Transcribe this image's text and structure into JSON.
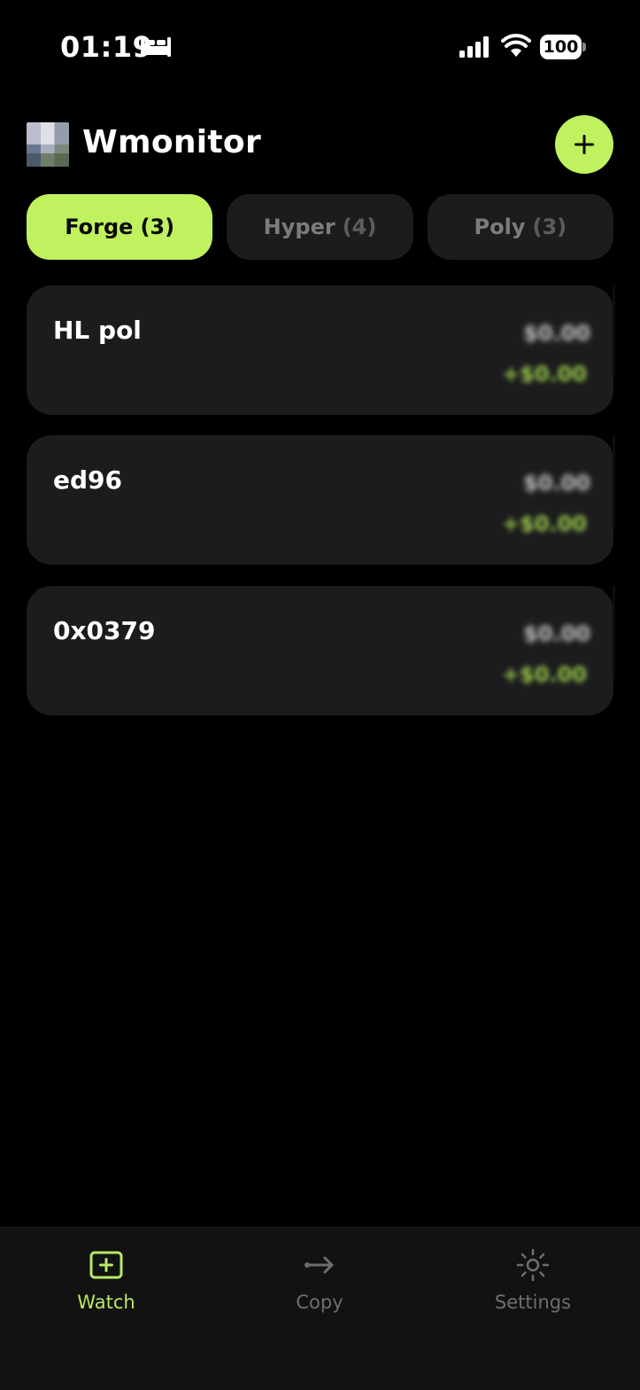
{
  "status_bar": {
    "time": "01:19",
    "battery": "100",
    "icons": [
      "sleep-icon",
      "signal-icon",
      "wifi-icon",
      "battery-icon"
    ]
  },
  "header": {
    "title": "Wmonitor",
    "add_icon": "plus-icon"
  },
  "tabs": [
    {
      "label": "Forge",
      "count": "(3)",
      "active": true
    },
    {
      "label": "Hyper",
      "count": "(4)",
      "active": false
    },
    {
      "label": "Poly",
      "count": "(3)",
      "active": false
    }
  ],
  "wallets": [
    {
      "name": "HL pol",
      "value": "$0.00",
      "change": "+$0.00"
    },
    {
      "name": "ed96",
      "value": "$0.00",
      "change": "+$0.00"
    },
    {
      "name": "0x0379",
      "value": "$0.00",
      "change": "+$0.00"
    }
  ],
  "bottom_nav": [
    {
      "label": "Watch",
      "icon": "watch-icon",
      "active": true
    },
    {
      "label": "Copy",
      "icon": "arrow-right-icon",
      "active": false
    },
    {
      "label": "Settings",
      "icon": "gear-icon",
      "active": false
    }
  ],
  "colors": {
    "accent": "#c0f15f",
    "card_bg": "#1c1c1e",
    "background": "#000000",
    "positive": "#98c84a"
  }
}
